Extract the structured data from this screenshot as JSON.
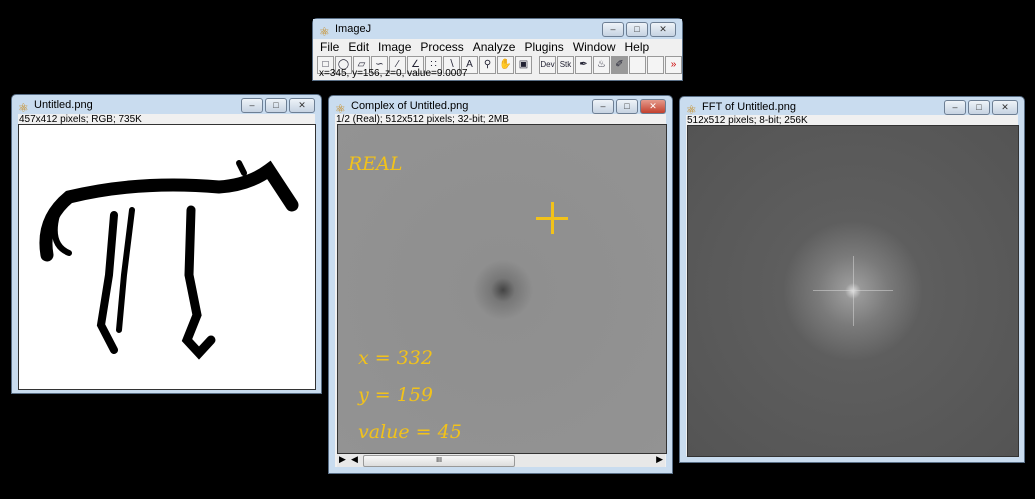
{
  "imagej": {
    "title": "ImageJ",
    "menu": [
      "File",
      "Edit",
      "Image",
      "Process",
      "Analyze",
      "Plugins",
      "Window",
      "Help"
    ],
    "tools": [
      "rectangle-tool",
      "oval-tool",
      "polygon-tool",
      "freehand-tool",
      "line-tool",
      "angle-tool",
      "point-tool",
      "wand-tool",
      "text-tool",
      "magnifier-tool",
      "hand-tool",
      "color-picker-tool",
      "dev-menu",
      "stk-menu",
      "brush-tool",
      "flood-fill-tool",
      "pencil-tool",
      "empty-1",
      "empty-2",
      "more-tools"
    ],
    "tool_labels": {
      "text": "A",
      "dev": "Dev",
      "stk": "Stk",
      "more": "»"
    },
    "status": "x=345, y=156, z=0, value=9.0007"
  },
  "untitled": {
    "title": "Untitled.png",
    "info": "457x412 pixels; RGB; 735K"
  },
  "complex": {
    "title": "Complex of Untitled.png",
    "info": "1/2 (Real); 512x512 pixels; 32-bit; 2MB",
    "label": "REAL",
    "x": "x = 332",
    "y": "y = 159",
    "value": "value = 45",
    "scroll_play": "▶",
    "scroll_thumb": "III"
  },
  "fft": {
    "title": "FFT of Untitled.png",
    "info": "512x512 pixels; 8-bit; 256K"
  },
  "colors": {
    "annotation": "#f2c21a"
  }
}
